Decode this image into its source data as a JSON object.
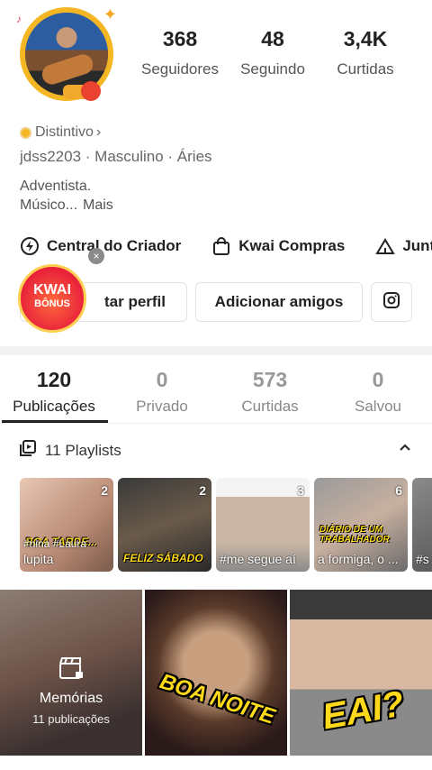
{
  "profile": {
    "stats": [
      {
        "value": "368",
        "label": "Seguidores"
      },
      {
        "value": "48",
        "label": "Seguindo"
      },
      {
        "value": "3,4K",
        "label": "Curtidas"
      }
    ],
    "badge_label": "Distintivo",
    "badge_chevron": "›",
    "info": "jdss2203 · Masculino · Áries",
    "bio_line1": "Adventista.",
    "bio_line2": "Músico...",
    "bio_more": "Mais"
  },
  "shortcuts": [
    {
      "label": "Central do Criador",
      "icon": "bolt-icon"
    },
    {
      "label": "Kwai Compras",
      "icon": "shopping-bag-icon"
    },
    {
      "label": "Junt",
      "icon": "tent-icon"
    }
  ],
  "buttons": {
    "edit_profile": "tar perfil",
    "add_friends": "Adicionar amigos"
  },
  "bonus": {
    "line1": "KWAI",
    "line2": "BÔNUS",
    "close": "×"
  },
  "tabs": [
    {
      "value": "120",
      "label": "Publicações"
    },
    {
      "value": "0",
      "label": "Privado"
    },
    {
      "value": "573",
      "label": "Curtidas"
    },
    {
      "value": "0",
      "label": "Salvou"
    }
  ],
  "playlists": {
    "title": "11 Playlists",
    "items": [
      {
        "count": "2",
        "caption": "lupita",
        "sticker": "BOA TARDE...",
        "sub": "#nina #Laura"
      },
      {
        "count": "2",
        "caption": "",
        "sticker": "FELIZ SÁBADO"
      },
      {
        "count": "3",
        "caption": "#me segue aí"
      },
      {
        "count": "6",
        "caption": "a formiga, o ...",
        "sticker": "DIÁRIO DE UM TRABALHADOR"
      },
      {
        "count": "",
        "caption": "#s"
      }
    ]
  },
  "grid": {
    "memorias_title": "Memórias",
    "memorias_sub": "11 publicações",
    "video2_sticker": "BOA NOITE",
    "video3_sticker": "EAI?"
  },
  "colors": {
    "accent": "#f5b623",
    "sticker": "#ffd91a"
  }
}
